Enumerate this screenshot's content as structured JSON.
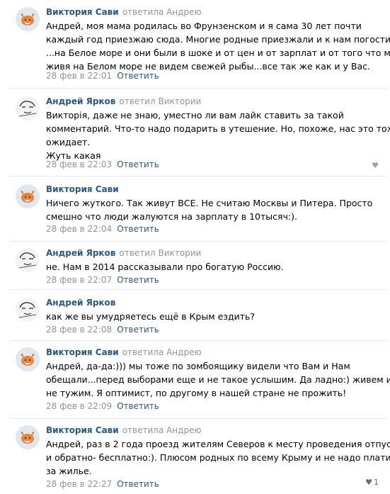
{
  "comments": [
    {
      "author": "Виктория Сави",
      "replied": "ответила Андрею",
      "avatar": "fox-avatar",
      "lines": [
        "Андрей, моя мама родилась во Фрунзенском и я сама 30 лет почти",
        "каждый год приезжаю сюда. Многие родные приезжали и к нам погостить",
        "...на Белое море и они были в шоке и от цен и от зарплат и от того что мы",
        "живя на Белом море не видем свежей рыбы...все так же как и у Вас."
      ],
      "date": "28 фев в 22:01",
      "reply": "Ответить",
      "like_count": ""
    },
    {
      "author": "Андрей Ярков",
      "replied": "ответил Виктории",
      "avatar": "sketch-avatar",
      "lines": [
        "Викторія, даже не знаю, уместно ли вам лайк ставить за такой",
        "комментарий. Что-то надо подарить в утешение. Но, похоже, нас это тоже",
        "ожидает.",
        "Жуть какая"
      ],
      "date": "28 фев в 22:03",
      "reply": "Ответить",
      "like_count": ""
    },
    {
      "author": "Виктория Сави",
      "replied": "",
      "avatar": "fox-avatar",
      "lines": [
        "Ничего жуткого. Так живут ВСЕ. Не считаю Москвы и Питера. Просто",
        "смешно что люди жалуются на зарплату в 10тысяч:)."
      ],
      "date": "28 фев в 22:04",
      "reply": "Ответить",
      "like_count": ""
    },
    {
      "author": "Андрей Ярков",
      "replied": "ответил Виктории",
      "avatar": "sketch-avatar",
      "lines": [
        "не. Нам в 2014 рассказывали про богатую Россию."
      ],
      "date": "28 фев в 22:07",
      "reply": "Ответить",
      "like_count": ""
    },
    {
      "author": "Андрей Ярков",
      "replied": "",
      "avatar": "sketch-avatar",
      "lines": [
        "как же вы умудряетесь ещё в Крым ездить?"
      ],
      "date": "28 фев в 22:08",
      "reply": "Ответить",
      "like_count": ""
    },
    {
      "author": "Виктория Сави",
      "replied": "ответила Андрею",
      "avatar": "fox-avatar",
      "lines": [
        "Андрей, да-да:))) мы тоже по зомбоящику видели что Вам и Нам",
        "обещали...перед выборами еще и не такое услышим. Да ладно:) живем и",
        "не тужим. Я оптимист, по другому в нашей стране не прожить!"
      ],
      "date": "28 фев в 22:09",
      "reply": "Ответить",
      "like_count": ""
    },
    {
      "author": "Виктория Сави",
      "replied": "ответила Андрею",
      "avatar": "fox-avatar",
      "lines": [
        "Андрей, раз в 2 года проезд жителям Северов к месту проведения отпуска",
        "и обратно- бесплатно:). Плюсом родных по всему Крыму и не надо платить",
        "за жилье."
      ],
      "date": "28 фев в 22:27",
      "reply": "Ответить",
      "like_count": "1"
    }
  ]
}
